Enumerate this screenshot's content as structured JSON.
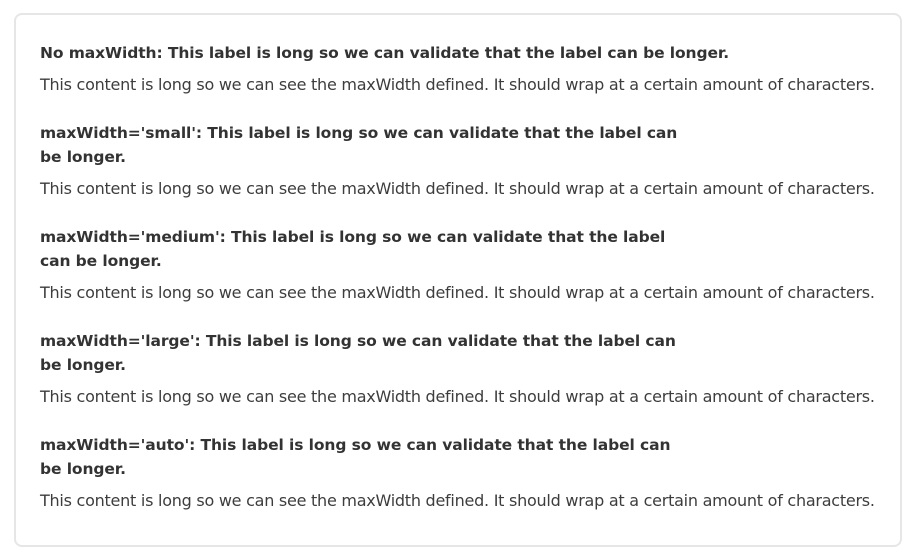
{
  "items": [
    {
      "label": "No maxWidth: This label is long so we can validate that the label can be longer.",
      "content": "This content is long so we can see the maxWidth defined. It should wrap at a certain amount of characters."
    },
    {
      "label": "maxWidth='small': This label is long so we can validate that the label can be longer.",
      "content": "This content is long so we can see the maxWidth defined. It should wrap at a certain amount of characters."
    },
    {
      "label": "maxWidth='medium': This label is long so we can validate that the label can be longer.",
      "content": "This content is long so we can see the maxWidth defined. It should wrap at a certain amount of characters."
    },
    {
      "label": "maxWidth='large': This label is long so we can validate that the label can be longer.",
      "content": "This content is long so we can see the maxWidth defined. It should wrap at a certain amount of characters."
    },
    {
      "label": "maxWidth='auto': This label is long so we can validate that the label can be longer.",
      "content": "This content is long so we can see the maxWidth defined. It should wrap at a certain amount of characters."
    }
  ]
}
